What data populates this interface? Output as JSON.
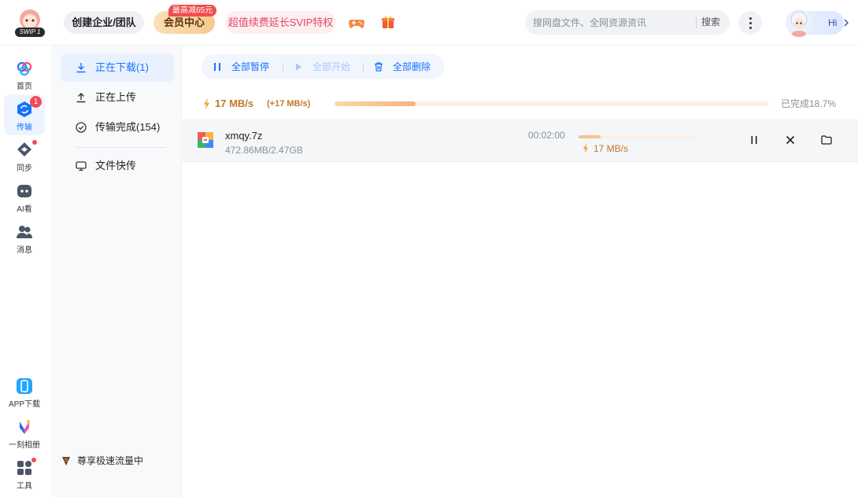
{
  "header": {
    "logo_text": "SWIP 1",
    "team_button": "创建企业/团队",
    "vip_button": "会员中心",
    "vip_badge": "最高减65元",
    "svip_promo": "超值续费延长SVIP特权",
    "search": {
      "placeholder": "搜网盘文件、全网资源资讯",
      "button": "搜索"
    },
    "greeting": "Hi"
  },
  "rail": {
    "items": [
      {
        "label": "首页",
        "icon": "cloud-home-icon"
      },
      {
        "label": "传输",
        "icon": "transfer-icon",
        "active": true,
        "badge": "1"
      },
      {
        "label": "同步",
        "icon": "sync-icon",
        "dot": true
      },
      {
        "label": "AI看",
        "icon": "ai-view-icon"
      },
      {
        "label": "消息",
        "icon": "message-icon"
      },
      {
        "label": "APP下载",
        "icon": "phone-icon"
      },
      {
        "label": "一刻相册",
        "icon": "album-icon"
      },
      {
        "label": "工具",
        "icon": "tools-icon",
        "dot": true
      }
    ]
  },
  "transfer_nav": {
    "items": [
      {
        "label": "正在下载(1)",
        "icon": "download-icon",
        "active": true
      },
      {
        "label": "正在上传",
        "icon": "upload-icon"
      },
      {
        "label": "传输完成(154)",
        "icon": "check-circle-icon"
      },
      {
        "label": "文件快传",
        "icon": "monitor-icon"
      }
    ],
    "promo": "尊享极速流量中"
  },
  "toolbar": {
    "pause_all": "全部暂停",
    "start_all": "全部开始",
    "delete_all": "全部删除"
  },
  "summary": {
    "speed": "17 MB/s",
    "speed_boost": "(+17 MB/s)",
    "progress_fraction": 0.187,
    "completed_text": "已完成18.7%"
  },
  "downloads": [
    {
      "name": "xmqy.7z",
      "size": "472.86MB/2.47GB",
      "time_left": "00:02:00",
      "progress_fraction": 0.187,
      "speed": "17 MB/s"
    }
  ],
  "colors": {
    "accent": "#1673ff",
    "speed": "#c2782e",
    "svip": "#e54866",
    "badge": "#f24957"
  }
}
